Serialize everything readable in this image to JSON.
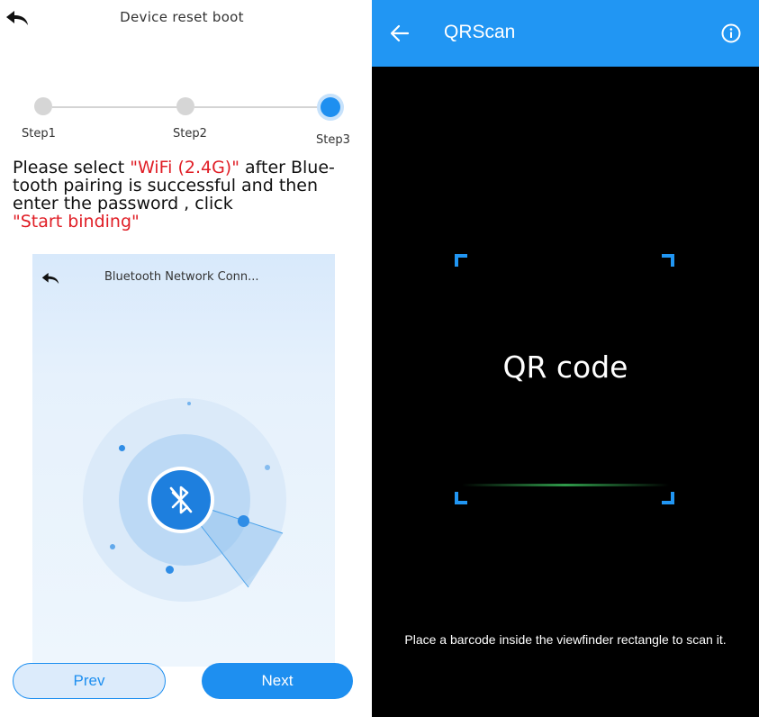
{
  "left_panel": {
    "title": "Device reset boot",
    "steps": [
      "Step1",
      "Step2",
      "Step3"
    ],
    "active_step": 3,
    "instruction": {
      "part1": "Please select ",
      "highlight1": "\"WiFi (2.4G)\"",
      "part2": " after Blue-tooth pairing is successful and then enter the password , click ",
      "highlight2": "\"Start binding\""
    },
    "preview": {
      "title": "Bluetooth Network Conn..."
    },
    "prev_label": "Prev",
    "next_label": "Next"
  },
  "right_panel": {
    "title": "QRScan",
    "center_text": "QR code",
    "hint": "Place a barcode inside the viewfinder rectangle to scan it."
  },
  "colors": {
    "accent": "#1e8ff0",
    "toolbar": "#2196f3",
    "highlight": "#e01e26",
    "scan_line": "#2f9a4a"
  }
}
